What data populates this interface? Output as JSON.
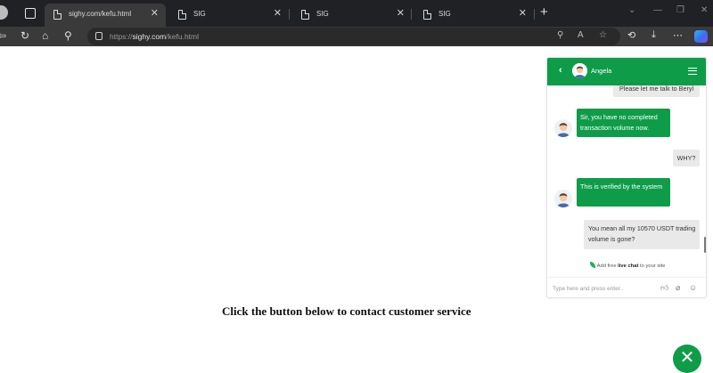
{
  "browser": {
    "tabs": [
      {
        "title": "sighy.com/kefu.html",
        "active": true
      },
      {
        "title": "SIG",
        "active": false
      },
      {
        "title": "SIG",
        "active": false
      },
      {
        "title": "SIG",
        "active": false
      }
    ],
    "url_scheme": "https://",
    "url_host": "sighy.com",
    "url_path": "/kefu.html"
  },
  "page": {
    "cta_text": "Click the button below to contact customer service"
  },
  "chat": {
    "agent_name": "Angela",
    "messages": [
      {
        "from": "user",
        "text": "Please let me talk to Beryl"
      },
      {
        "from": "agent",
        "text": "Sir, you have no completed transaction volume now."
      },
      {
        "from": "user",
        "text": "WHY?"
      },
      {
        "from": "agent",
        "text": "This is verified by the system"
      },
      {
        "from": "user",
        "text": "You mean all my 10570 USDT trading volume is gone?"
      }
    ],
    "powered_prefix": "Add free",
    "powered_bold": "live chat",
    "powered_suffix": "to your site",
    "input_placeholder": "Type here and press enter..",
    "accent_color": "#0f9c49"
  }
}
